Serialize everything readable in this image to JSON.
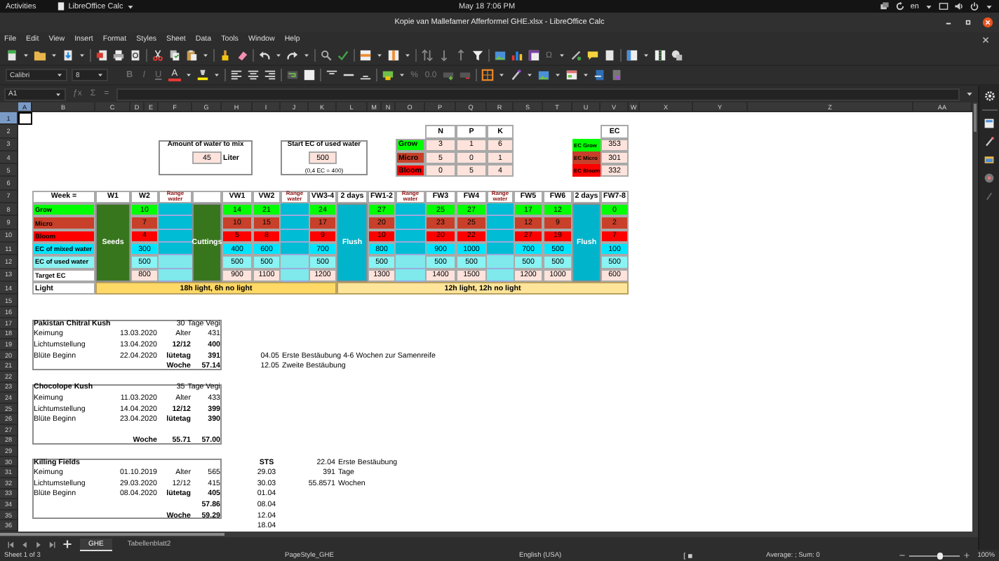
{
  "top_bar": {
    "activities": "Activities",
    "app_menu": "LibreOffice Calc",
    "clock": "May 18  7:06 PM",
    "keyboard": "en"
  },
  "window": {
    "title": "Kopie van Mallefamer Afferformel GHE.xlsx - LibreOffice Calc"
  },
  "menu": [
    "File",
    "Edit",
    "View",
    "Insert",
    "Format",
    "Styles",
    "Sheet",
    "Data",
    "Tools",
    "Window",
    "Help"
  ],
  "toolbar": {
    "special_character": "Ω"
  },
  "formatting": {
    "font_name": "Calibri",
    "font_size": "8",
    "format_buttons": [
      {
        "label": "B",
        "kind": "bold",
        "disabled": true
      },
      {
        "label": "I",
        "kind": "italic",
        "disabled": true
      },
      {
        "label": "U",
        "kind": "underline",
        "disabled": true
      },
      {
        "label": "A",
        "kind": "font_color",
        "disabled": false
      }
    ],
    "number_buttons": [
      "%",
      "0.0"
    ]
  },
  "formula_bar": {
    "name_box": "A1",
    "buttons": [
      "ƒx",
      "Σ",
      "="
    ]
  },
  "sheet": {
    "columns": [
      {
        "label": "A",
        "selected": true
      },
      {
        "label": "B",
        "selected": false
      },
      {
        "label": "C",
        "selected": false
      },
      {
        "label": "D",
        "selected": false
      },
      {
        "label": "E",
        "selected": false
      },
      {
        "label": "F",
        "selected": false
      },
      {
        "label": "G",
        "selected": false
      },
      {
        "label": "H",
        "selected": false
      },
      {
        "label": "I",
        "selected": false
      },
      {
        "label": "J",
        "selected": false
      },
      {
        "label": "K",
        "selected": false
      },
      {
        "label": "L",
        "selected": false
      },
      {
        "label": "M",
        "selected": false
      },
      {
        "label": "N",
        "selected": false
      },
      {
        "label": "O",
        "selected": false
      },
      {
        "label": "P",
        "selected": false
      },
      {
        "label": "Q",
        "selected": false
      },
      {
        "label": "R",
        "selected": false
      },
      {
        "label": "S",
        "selected": false
      },
      {
        "label": "T",
        "selected": false
      },
      {
        "label": "U",
        "selected": false
      },
      {
        "label": "V",
        "selected": false
      },
      {
        "label": "W",
        "selected": false
      },
      {
        "label": "X",
        "selected": false
      },
      {
        "label": "Y",
        "selected": false
      },
      {
        "label": "Z",
        "selected": false
      },
      {
        "label": "AA",
        "selected": false
      }
    ],
    "rows": [
      {
        "label": "1",
        "selected": true
      },
      {
        "label": "2",
        "selected": false
      },
      {
        "label": "3",
        "selected": false
      },
      {
        "label": "4",
        "selected": false
      },
      {
        "label": "5",
        "selected": false
      },
      {
        "label": "6",
        "selected": false
      },
      {
        "label": "7",
        "selected": false
      },
      {
        "label": "8",
        "selected": false
      },
      {
        "label": "9",
        "selected": false
      },
      {
        "label": "10",
        "selected": false
      },
      {
        "label": "11",
        "selected": false
      },
      {
        "label": "12",
        "selected": false
      },
      {
        "label": "13",
        "selected": false
      },
      {
        "label": "14",
        "selected": false
      },
      {
        "label": "15",
        "selected": false
      },
      {
        "label": "16",
        "selected": false
      },
      {
        "label": "17",
        "selected": false
      },
      {
        "label": "18",
        "selected": false
      },
      {
        "label": "19",
        "selected": false
      },
      {
        "label": "20",
        "selected": false
      },
      {
        "label": "21",
        "selected": false
      },
      {
        "label": "22",
        "selected": false
      },
      {
        "label": "23",
        "selected": false
      },
      {
        "label": "24",
        "selected": false
      },
      {
        "label": "25",
        "selected": false
      },
      {
        "label": "26",
        "selected": false
      },
      {
        "label": "27",
        "selected": false
      },
      {
        "label": "28",
        "selected": false
      },
      {
        "label": "29",
        "selected": false
      },
      {
        "label": "30",
        "selected": false
      },
      {
        "label": "31",
        "selected": false
      },
      {
        "label": "32",
        "selected": false
      },
      {
        "label": "33",
        "selected": false
      },
      {
        "label": "34",
        "selected": false
      },
      {
        "label": "35",
        "selected": false
      },
      {
        "label": "36",
        "selected": false
      }
    ],
    "water_box": {
      "label": "Amount of water to mix",
      "value": "45",
      "unit": "Liter"
    },
    "ec_box": {
      "label": "Start EC of used water",
      "value": "500",
      "note": "(0,4 EC = 400)"
    },
    "npk_table": {
      "columns": [
        "N",
        "P",
        "K"
      ],
      "rows": [
        {
          "name": "Grow",
          "color": "#00ff00",
          "values": [
            "3",
            "1",
            "6"
          ]
        },
        {
          "name": "Micro",
          "color": "#c8402a",
          "values": [
            "5",
            "0",
            "1"
          ]
        },
        {
          "name": "Bloom",
          "color": "#ff0000",
          "values": [
            "0",
            "5",
            "4"
          ]
        }
      ]
    },
    "ec_table": {
      "column": "EC",
      "rows": [
        {
          "name": "EC Grow",
          "color": "#00ff00",
          "value": "353"
        },
        {
          "name": "EC Micro",
          "color": "#c8402a",
          "value": "301"
        },
        {
          "name": "EC Bloom",
          "color": "#ff0000",
          "value": "332"
        }
      ]
    },
    "schedule": {
      "header_label": "Week =",
      "rows": [
        {
          "kind": "nutrient",
          "label": "Grow",
          "color": "#00ff00"
        },
        {
          "kind": "nutrient",
          "label": "Micro",
          "color": "#c8402a"
        },
        {
          "kind": "nutrient",
          "label": "Bloom",
          "color": "#ff0000"
        },
        {
          "kind": "ec",
          "label": "EC of mixed water",
          "color": "#00e5ff"
        },
        {
          "kind": "ec",
          "label": "EC of used water",
          "color": "#8af3f3"
        },
        {
          "kind": "target",
          "label": "Target EC",
          "color": "#ffffff"
        }
      ],
      "columns": [
        {
          "kind": "phase",
          "header": "W1",
          "label": "Seeds",
          "color": "#38761d"
        },
        {
          "kind": "week",
          "header": "W2",
          "values": [
            "10",
            "7",
            "4",
            "300",
            "500",
            "800"
          ]
        },
        {
          "kind": "range",
          "header": "Range water"
        },
        {
          "kind": "phase",
          "label": "Cuttings",
          "color": "#38761d"
        },
        {
          "kind": "week",
          "header": "VW1",
          "values": [
            "14",
            "10",
            "5",
            "400",
            "500",
            "900"
          ]
        },
        {
          "kind": "week",
          "header": "VW2",
          "values": [
            "21",
            "15",
            "8",
            "600",
            "500",
            "1100"
          ]
        },
        {
          "kind": "range",
          "header": "Range water"
        },
        {
          "kind": "week",
          "header": "VW3-4",
          "values": [
            "24",
            "17",
            "9",
            "700",
            "500",
            "1200"
          ]
        },
        {
          "kind": "phase",
          "header": "2 days",
          "label": "Flush",
          "color": "#00b4cc"
        },
        {
          "kind": "week",
          "header": "FW1-2",
          "values": [
            "27",
            "20",
            "10",
            "800",
            "500",
            "1300"
          ]
        },
        {
          "kind": "range",
          "header": "Range water"
        },
        {
          "kind": "week",
          "header": "FW3",
          "values": [
            "25",
            "23",
            "20",
            "900",
            "500",
            "1400"
          ]
        },
        {
          "kind": "week",
          "header": "FW4",
          "values": [
            "27",
            "25",
            "22",
            "1000",
            "500",
            "1500"
          ]
        },
        {
          "kind": "range",
          "header": "Range water"
        },
        {
          "kind": "week",
          "header": "FW5",
          "values": [
            "17",
            "12",
            "27",
            "700",
            "500",
            "1200"
          ]
        },
        {
          "kind": "week",
          "header": "FW6",
          "values": [
            "12",
            "9",
            "19",
            "500",
            "500",
            "1000"
          ]
        },
        {
          "kind": "phase",
          "header": "2 days",
          "label": "Flush",
          "color": "#00b4cc"
        },
        {
          "kind": "week",
          "header": "FW7-8",
          "values": [
            "0",
            "2",
            "7",
            "100",
            "500",
            "600"
          ]
        }
      ],
      "light": {
        "label": "Light",
        "periods": [
          {
            "label": "18h light, 6h no light",
            "color": "#ffd966"
          },
          {
            "label": "12h light, 12h no light",
            "color": "#ffe599"
          }
        ]
      }
    },
    "strains": [
      {
        "name": "Pakistan Chitral Kush",
        "days": "30",
        "days_label": "Tage Vegi",
        "rows": [
          {
            "kind": "entry",
            "label": "Keimung",
            "detail": "13.03.2020",
            "key": "Alter",
            "value": "431",
            "bold": false
          },
          {
            "kind": "entry",
            "label": "Lichtumstellung",
            "detail": "13.04.2020",
            "key": "12/12",
            "value": "400",
            "bold": true
          },
          {
            "kind": "entry",
            "label": "Blüte Beginn",
            "detail": "22.04.2020",
            "key": "lütetag",
            "value": "391",
            "bold": true
          },
          {
            "kind": "total",
            "key": "Woche",
            "value": "57.14"
          }
        ]
      },
      {
        "name": "Chocolope Kush",
        "days": "35",
        "days_label": "Tage Vegi",
        "rows": [
          {
            "kind": "entry",
            "label": "Keimung",
            "detail": "11.03.2020",
            "key": "Alter",
            "value": "433",
            "bold": false
          },
          {
            "kind": "entry",
            "label": "Lichtumstellung",
            "detail": "14.04.2020",
            "key": "12/12",
            "value": "399",
            "bold": true
          },
          {
            "kind": "entry",
            "label": "Blüte Beginn",
            "detail": "23.04.2020",
            "key": "lütetag",
            "value": "390",
            "bold": true
          },
          {
            "kind": "spacer"
          },
          {
            "kind": "total",
            "detail": "Woche",
            "key": "55.71",
            "value": "57.00"
          }
        ]
      },
      {
        "name": "Killing Fields",
        "rows": [
          {
            "kind": "entry",
            "label": "Keimung",
            "detail": "01.10.2019",
            "key": "Alter",
            "value": "565",
            "bold": false
          },
          {
            "kind": "entry",
            "label": "Lichtumstellung",
            "detail": "29.03.2020",
            "key": "12/12",
            "value": "415",
            "bold": false
          },
          {
            "kind": "entry",
            "label": "Blüte Beginn",
            "detail": "08.04.2020",
            "key": "lütetag",
            "value": "405",
            "bold": true
          },
          {
            "kind": "total",
            "value": "57.86"
          },
          {
            "kind": "total",
            "key": "Woche",
            "value": "59.29"
          }
        ]
      }
    ],
    "pollination_notes": [
      {
        "date": "04.05",
        "text": "Erste Bestäubung 4-6 Wochen zur Samenreife"
      },
      {
        "date": "12.05",
        "text": "Zweite Bestäubung"
      }
    ],
    "sts": {
      "title": "STS",
      "dates": [
        "29.03",
        "30.03",
        "01.04",
        "08.04",
        "12.04",
        "18.04"
      ]
    },
    "summary": [
      {
        "value": "22.04",
        "text": "Erste Bestäubung"
      },
      {
        "value": "391",
        "text": "Tage"
      },
      {
        "value": "55.8571",
        "text": "Wochen"
      }
    ]
  },
  "sheet_tabs": [
    {
      "label": "GHE",
      "selected": true
    },
    {
      "label": "Tabellenblatt2",
      "selected": false
    }
  ],
  "status_bar": {
    "sheet": "Sheet 1 of 3",
    "page_style": "PageStyle_GHE",
    "language": "English (USA)",
    "selection": "Average: ; Sum: 0",
    "zoom": {
      "level": 0.62,
      "reading": "100%"
    }
  }
}
